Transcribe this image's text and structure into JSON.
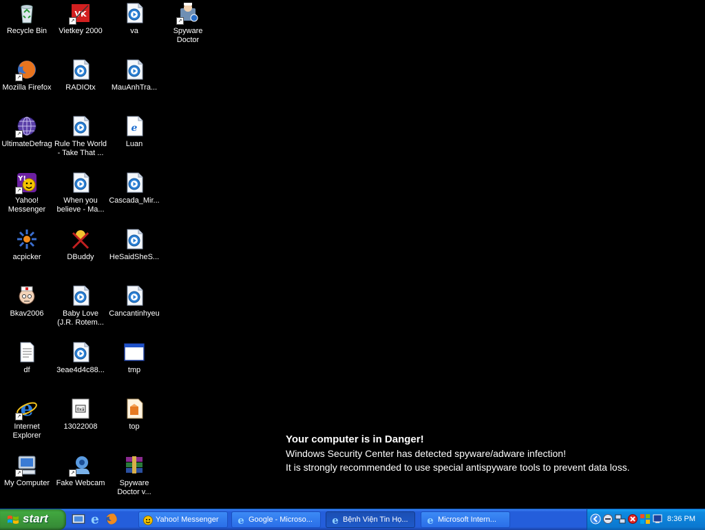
{
  "desktop": {
    "icons": [
      {
        "label": "Recycle Bin",
        "icon": "recycle-bin-icon",
        "shortcut": false
      },
      {
        "label": "Vietkey 2000",
        "icon": "vietkey-icon",
        "shortcut": true
      },
      {
        "label": "va",
        "icon": "media-file-icon",
        "shortcut": false
      },
      {
        "label": "Spyware\nDoctor",
        "icon": "spyware-doctor-icon",
        "shortcut": true
      },
      {
        "label": "Mozilla Firefox",
        "icon": "firefox-icon",
        "shortcut": true
      },
      {
        "label": "RADIOtx",
        "icon": "media-file-icon",
        "shortcut": false
      },
      {
        "label": "MauAnhTra...",
        "icon": "media-file-icon",
        "shortcut": false
      },
      {
        "label": "UltimateDefrag",
        "icon": "ultimatedefrag-icon",
        "shortcut": true
      },
      {
        "label": "Rule The World\n- Take That ...",
        "icon": "media-file-icon",
        "shortcut": false
      },
      {
        "label": "Luan",
        "icon": "html-file-icon",
        "shortcut": false
      },
      {
        "label": "Yahoo!\nMessenger",
        "icon": "yahoo-messenger-icon",
        "shortcut": true
      },
      {
        "label": "When you\nbelieve - Ma...",
        "icon": "media-file-icon",
        "shortcut": false
      },
      {
        "label": "Cascada_Mir...",
        "icon": "media-file-icon",
        "shortcut": false
      },
      {
        "label": "acpicker",
        "icon": "acpicker-icon",
        "shortcut": false
      },
      {
        "label": "DBuddy",
        "icon": "dbuddy-icon",
        "shortcut": false
      },
      {
        "label": "HeSaidSheS...",
        "icon": "media-file-icon",
        "shortcut": false
      },
      {
        "label": "Bkav2006",
        "icon": "bkav-icon",
        "shortcut": false
      },
      {
        "label": "Baby Love\n(J.R. Rotem...",
        "icon": "media-file-icon",
        "shortcut": false
      },
      {
        "label": "Cancantinhyeu",
        "icon": "media-file-icon",
        "shortcut": false
      },
      {
        "label": "df",
        "icon": "text-file-icon",
        "shortcut": false
      },
      {
        "label": "3eae4d4c88...",
        "icon": "media-file-icon",
        "shortcut": false
      },
      {
        "label": "tmp",
        "icon": "window-file-icon",
        "shortcut": false
      },
      {
        "label": "Internet\nExplorer",
        "icon": "internet-explorer-icon",
        "shortcut": true
      },
      {
        "label": "13022008",
        "icon": "image-file-icon",
        "shortcut": false
      },
      {
        "label": "top",
        "icon": "top-file-icon",
        "shortcut": false
      },
      {
        "label": "My Computer",
        "icon": "my-computer-icon",
        "shortcut": true
      },
      {
        "label": "Fake Webcam",
        "icon": "fake-webcam-icon",
        "shortcut": true
      },
      {
        "label": "Spyware\nDoctor v...",
        "icon": "winrar-archive-icon",
        "shortcut": false
      }
    ]
  },
  "warning": {
    "title": "Your computer is in Danger!",
    "line1": "Windows Security Center has detected spyware/adware infection!",
    "line2": "It is strongly recommended to use special antispyware tools to prevent data loss."
  },
  "taskbar": {
    "start_label": "start",
    "quick_launch": [
      "show-desktop-icon",
      "internet-explorer-icon",
      "firefox-icon"
    ],
    "tasks": [
      {
        "label": "Yahoo! Messenger",
        "icon": "yahoo-messenger-icon",
        "active": false
      },
      {
        "label": "Google - Microso...",
        "icon": "ie-window-icon",
        "active": false
      },
      {
        "label": "Bệnh Viện Tin Họ...",
        "icon": "ie-window-icon",
        "active": true
      },
      {
        "label": "Microsoft Intern...",
        "icon": "ie-window-icon",
        "active": false
      }
    ],
    "tray_icons": [
      "chevron-left-icon",
      "minus-circle-icon",
      "network-icon",
      "red-x-icon",
      "security-icon",
      "display-icon"
    ],
    "clock": "8:36 PM"
  },
  "colors": {
    "desktop_bg": "#000000",
    "taskbar_blue": "#245edb",
    "start_green": "#3c9a3c",
    "tray_blue": "#0b78d0"
  }
}
